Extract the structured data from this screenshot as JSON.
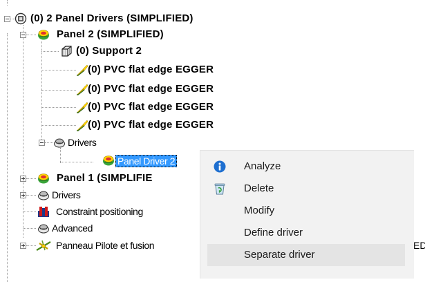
{
  "tree": {
    "root": {
      "label": "(0) 2 Panel Drivers (SIMPLIFIED)",
      "icon": "assembly-root-icon"
    },
    "panel2": {
      "label": "Panel 2  (SIMPLIFIED)",
      "icon": "panel-part-icon"
    },
    "support2": {
      "label": "(0) Support 2",
      "icon": "box-wireframe-icon"
    },
    "edges": [
      {
        "label": "(0) PVC flat edge EGGER",
        "icon": "edge-banding-icon"
      },
      {
        "label": "(0) PVC flat edge EGGER",
        "icon": "edge-banding-icon"
      },
      {
        "label": "(0) PVC flat edge EGGER",
        "icon": "edge-banding-icon"
      },
      {
        "label": "(0) PVC flat edge EGGER",
        "icon": "edge-banding-icon"
      }
    ],
    "drivers_inner": {
      "label": "Drivers",
      "icon": "drivers-folder-icon"
    },
    "panel_driver2": {
      "label": "Panel Driver 2",
      "icon": "panel-part-icon",
      "selected": true
    },
    "panel1": {
      "label": "Panel 1  (SIMPLIFIE",
      "icon": "panel-part-icon"
    },
    "drivers_outer": {
      "label": "Drivers",
      "icon": "drivers-folder-icon"
    },
    "constraint": {
      "label": "Constraint positioning",
      "icon": "constraint-icon"
    },
    "advanced": {
      "label": "Advanced",
      "icon": "drivers-folder-icon"
    },
    "panneau": {
      "label": "Panneau Pilote et fusion",
      "icon": "pilot-fusion-icon",
      "clipped_tail": "ED"
    }
  },
  "context_menu": {
    "items": [
      {
        "label": "Analyze",
        "icon": "info-icon"
      },
      {
        "label": "Delete",
        "icon": "recycle-bin-icon"
      },
      {
        "label": "Modify",
        "icon": ""
      },
      {
        "label": "Define driver",
        "icon": ""
      },
      {
        "label": "Separate driver",
        "icon": "",
        "hovered": true
      }
    ]
  },
  "colors": {
    "selection": "#3399ff",
    "menu_background": "#f2f2f2",
    "menu_hover": "#e4e4e4",
    "info_blue": "#1e6fd0"
  }
}
